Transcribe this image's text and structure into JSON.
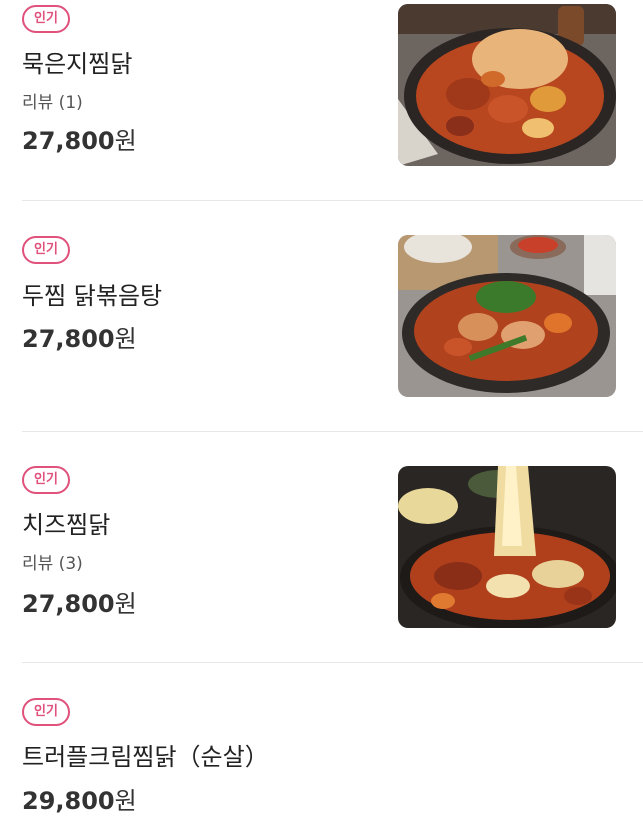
{
  "menu": {
    "items": [
      {
        "badge": "인기",
        "name": "묵은지찜닭",
        "review": "리뷰 (1)",
        "price": "27,800",
        "currency": "원",
        "image_icon": "kimchi-braised-chicken-photo"
      },
      {
        "badge": "인기",
        "name": "두찜 닭볶음탕",
        "review": "",
        "price": "27,800",
        "currency": "원",
        "image_icon": "spicy-chicken-stew-photo"
      },
      {
        "badge": "인기",
        "name": "치즈찜닭",
        "review": "리뷰 (3)",
        "price": "27,800",
        "currency": "원",
        "image_icon": "cheese-braised-chicken-photo"
      },
      {
        "badge": "인기",
        "name": "트러플크림찜닭（순살）",
        "review": "",
        "price": "29,800",
        "currency": "원"
      }
    ]
  },
  "colors": {
    "badge": "#e0517c",
    "text": "#222222",
    "divider": "#e8e8e8"
  }
}
